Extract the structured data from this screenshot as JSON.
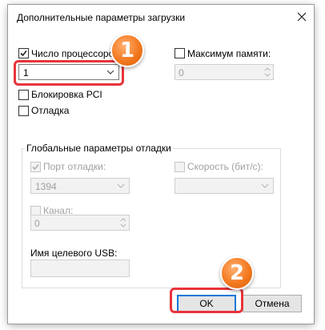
{
  "dialog": {
    "title": "Дополнительные параметры загрузки"
  },
  "processors": {
    "label": "Число процессоров",
    "checked": true,
    "value": "1"
  },
  "memory": {
    "label": "Максимум памяти:",
    "checked": false,
    "value": "0"
  },
  "pci_lock": {
    "label": "Блокировка PCI",
    "checked": false
  },
  "debug": {
    "label": "Отладка",
    "checked": false
  },
  "global_debug": {
    "title": "Глобальные параметры отладки",
    "debug_port_label": "Порт отладки:",
    "debug_port_checked": true,
    "debug_port_value": "1394",
    "baud_label": "Скорость (бит/с):",
    "baud_value": "",
    "channel_label": "Канал:",
    "channel_value": "0",
    "usb_target_label": "Имя целевого USB:",
    "usb_target_value": ""
  },
  "buttons": {
    "ok": "OK",
    "cancel": "Отмена"
  },
  "markers": {
    "first": "1",
    "second": "2"
  },
  "colors": {
    "highlight": "#e8343b",
    "marker": "#f3791f",
    "default_button_border": "#0078d7"
  },
  "icons": [
    "close-icon",
    "check-icon",
    "chevron-down-icon",
    "spin-arrows-icon"
  ]
}
